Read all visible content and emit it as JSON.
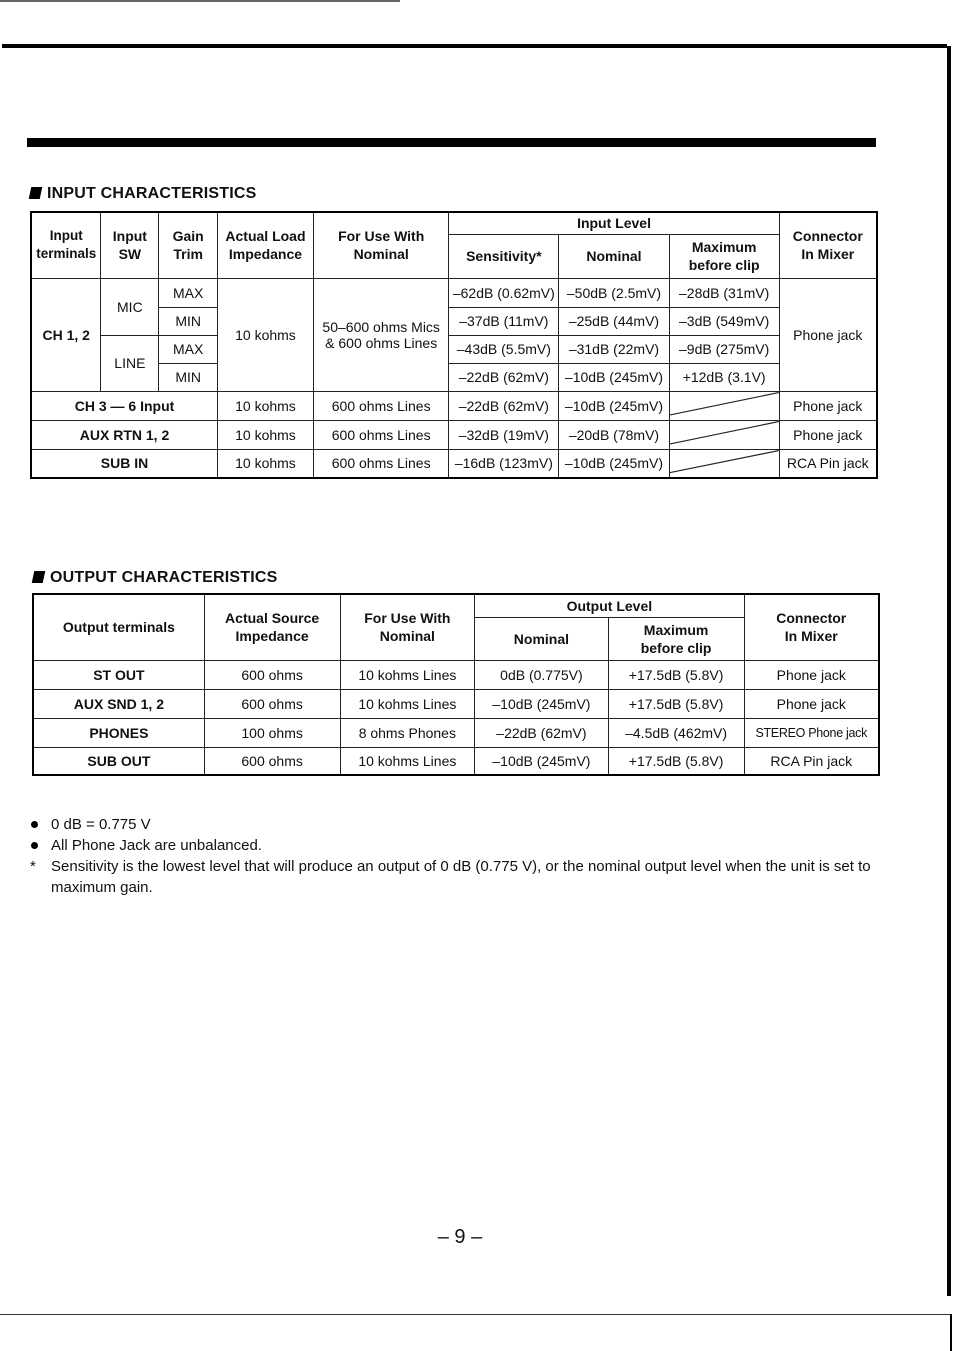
{
  "input_section": {
    "title": "INPUT CHARACTERISTICS",
    "headers": {
      "input_terminals": "Input terminals",
      "input_sw": "Input SW",
      "gain_trim": "Gain Trim",
      "actual_load_impedance": "Actual Load Impedance",
      "for_use_with_nominal": "For Use With Nominal",
      "input_level": "Input Level",
      "sensitivity": "Sensitivity*",
      "nominal": "Nominal",
      "maximum_before_clip": "Maximum before clip",
      "connector_in_mixer": "Connector In Mixer"
    },
    "ch12": {
      "terminal": "CH 1, 2",
      "impedance": "10 kohms",
      "for_use_with": "50–600 ohms Mics & 600 ohms Lines",
      "connector": "Phone jack",
      "rows": [
        {
          "sw": "MIC",
          "trim": "MAX",
          "sensitivity": "–62dB (0.62mV)",
          "nominal": "–50dB (2.5mV)",
          "max": "–28dB (31mV)"
        },
        {
          "sw": "MIC",
          "trim": "MIN",
          "sensitivity": "–37dB (11mV)",
          "nominal": "–25dB (44mV)",
          "max": "–3dB (549mV)"
        },
        {
          "sw": "LINE",
          "trim": "MAX",
          "sensitivity": "–43dB (5.5mV)",
          "nominal": "–31dB (22mV)",
          "max": "–9dB (275mV)"
        },
        {
          "sw": "LINE",
          "trim": "MIN",
          "sensitivity": "–22dB (62mV)",
          "nominal": "–10dB (245mV)",
          "max": "+12dB (3.1V)"
        }
      ]
    },
    "other_rows": [
      {
        "terminal": "CH 3 — 6 Input",
        "impedance": "10 kohms",
        "for_use_with": "600 ohms Lines",
        "sensitivity": "–22dB (62mV)",
        "nominal": "–10dB (245mV)",
        "max": "",
        "connector": "Phone jack"
      },
      {
        "terminal": "AUX RTN 1, 2",
        "impedance": "10 kohms",
        "for_use_with": "600 ohms Lines",
        "sensitivity": "–32dB (19mV)",
        "nominal": "–20dB (78mV)",
        "max": "",
        "connector": "Phone jack"
      },
      {
        "terminal": "SUB IN",
        "impedance": "10 kohms",
        "for_use_with": "600 ohms Lines",
        "sensitivity": "–16dB (123mV)",
        "nominal": "–10dB (245mV)",
        "max": "",
        "connector": "RCA Pin jack"
      }
    ]
  },
  "output_section": {
    "title": "OUTPUT CHARACTERISTICS",
    "headers": {
      "output_terminals": "Output terminals",
      "actual_source_impedance": "Actual Source Impedance",
      "for_use_with_nominal": "For Use With Nominal",
      "output_level": "Output Level",
      "nominal": "Nominal",
      "maximum_before_clip": "Maximum before clip",
      "connector_in_mixer": "Connector In Mixer"
    },
    "rows": [
      {
        "terminal": "ST OUT",
        "impedance": "600 ohms",
        "for_use_with": "10 kohms Lines",
        "nominal": "0dB (0.775V)",
        "max": "+17.5dB (5.8V)",
        "connector": "Phone jack"
      },
      {
        "terminal": "AUX SND 1, 2",
        "impedance": "600 ohms",
        "for_use_with": "10 kohms Lines",
        "nominal": "–10dB (245mV)",
        "max": "+17.5dB (5.8V)",
        "connector": "Phone jack"
      },
      {
        "terminal": "PHONES",
        "impedance": "100 ohms",
        "for_use_with": "8 ohms Phones",
        "nominal": "–22dB (62mV)",
        "max": "–4.5dB (462mV)",
        "connector": "STEREO Phone jack"
      },
      {
        "terminal": "SUB OUT",
        "impedance": "600 ohms",
        "for_use_with": "10 kohms Lines",
        "nominal": "–10dB (245mV)",
        "max": "+17.5dB (5.8V)",
        "connector": "RCA Pin jack"
      }
    ]
  },
  "notes": [
    {
      "marker": "bullet",
      "text": "0 dB = 0.775 V"
    },
    {
      "marker": "bullet",
      "text": "All Phone Jack are unbalanced."
    },
    {
      "marker": "*",
      "text": "Sensitivity is the lowest level that will produce an output of 0 dB (0.775 V), or the nominal output level when the unit is set to maximum gain."
    }
  ],
  "page_number": "– 9 –"
}
